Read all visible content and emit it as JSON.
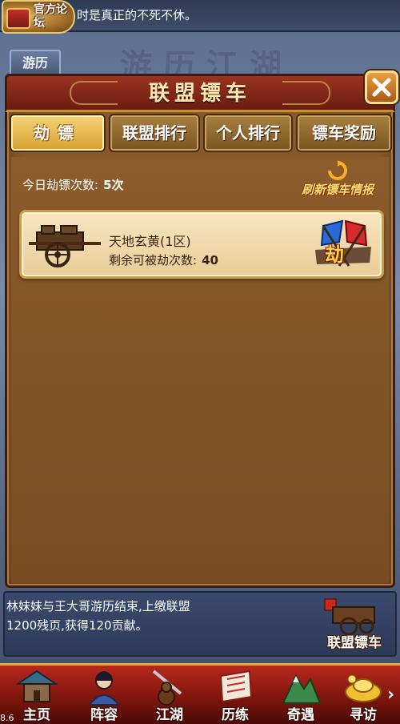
{
  "top_bar": {
    "forum_badge": "官方论坛",
    "marquee": "时是真正的不死不休。"
  },
  "background": {
    "tab_label": "游历",
    "scene_title": "游历江湖"
  },
  "panel": {
    "title": "联盟镖车",
    "tabs": [
      {
        "label": "劫镖",
        "active": true
      },
      {
        "label": "联盟排行",
        "active": false
      },
      {
        "label": "个人排行",
        "active": false
      },
      {
        "label": "镖车奖励",
        "active": false
      }
    ],
    "rob_count_label": "今日劫镖次数:",
    "rob_count_value": "5次",
    "refresh_label": "刷新镖车情报",
    "escorts": [
      {
        "name": "天地玄黄(1区)",
        "remaining_label": "剩余可被劫次数:",
        "remaining_value": "40",
        "action_label": "劫"
      }
    ]
  },
  "news": {
    "line1": "林妹妹与王大哥游历结束,上缴联盟",
    "line2": "1200残页,获得120贡献。",
    "button_label": "联盟镖车"
  },
  "bottom_nav": [
    {
      "label": "主页"
    },
    {
      "label": "阵容"
    },
    {
      "label": "江湖"
    },
    {
      "label": "历练"
    },
    {
      "label": "奇遇"
    },
    {
      "label": "寻访"
    }
  ],
  "nav_more": "›",
  "version": "8.6",
  "colors": {
    "panel_brown": "#8a5a2c",
    "header_red": "#9a3320",
    "tab_active_gold": "#f4d478",
    "card_cream": "#f8e6c0",
    "nav_red": "#b8281c"
  }
}
